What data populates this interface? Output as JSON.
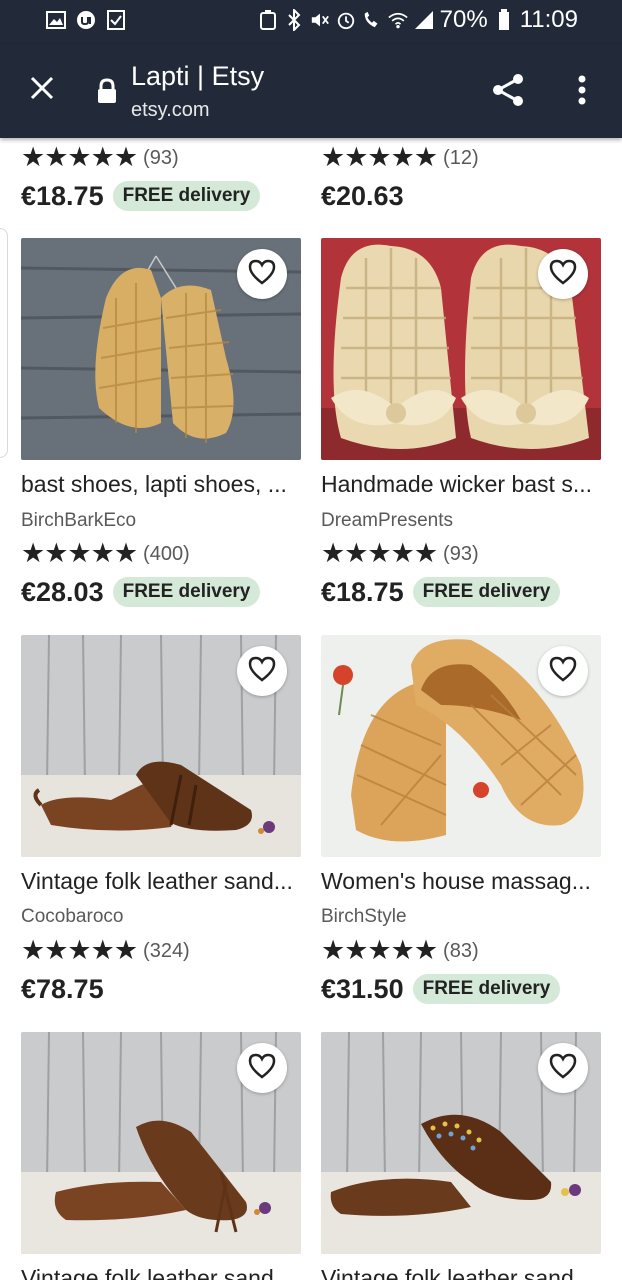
{
  "status_bar": {
    "battery": "70%",
    "time": "11:09"
  },
  "toolbar": {
    "title": "Lapti | Etsy",
    "url": "etsy.com"
  },
  "top_row": [
    {
      "stars": "★★★★★",
      "count": "(93)",
      "price": "€18.75",
      "badge": "FREE delivery"
    },
    {
      "stars": "★★★★★",
      "count": "(12)",
      "price": "€20.63",
      "badge": ""
    }
  ],
  "listings": [
    {
      "title": "bast shoes, lapti shoes, ...",
      "shop": "BirchBarkEco",
      "stars": "★★★★★",
      "count": "(400)",
      "price": "€28.03",
      "badge": "FREE delivery"
    },
    {
      "title": "Handmade wicker bast s...",
      "shop": "DreamPresents",
      "stars": "★★★★★",
      "count": "(93)",
      "price": "€18.75",
      "badge": "FREE delivery"
    },
    {
      "title": "Vintage folk leather sand...",
      "shop": "Cocobaroco",
      "stars": "★★★★★",
      "count": "(324)",
      "price": "€78.75",
      "badge": ""
    },
    {
      "title": "Women's house massag...",
      "shop": "BirchStyle",
      "stars": "★★★★★",
      "count": "(83)",
      "price": "€31.50",
      "badge": "FREE delivery"
    },
    {
      "title": "Vintage folk leather sand...",
      "shop": "",
      "stars": "",
      "count": "",
      "price": "",
      "badge": ""
    },
    {
      "title": "Vintage folk leather sand...",
      "shop": "",
      "stars": "",
      "count": "",
      "price": "",
      "badge": ""
    }
  ],
  "colors": {
    "toolbar_bg": "#222a3a",
    "badge_bg": "#d4e9d7",
    "text": "#222222",
    "muted": "#595959"
  },
  "icons": {
    "close": "close-icon",
    "lock": "lock-icon",
    "share": "share-icon",
    "menu": "more-vert-icon",
    "favorite": "heart-outline-icon"
  }
}
